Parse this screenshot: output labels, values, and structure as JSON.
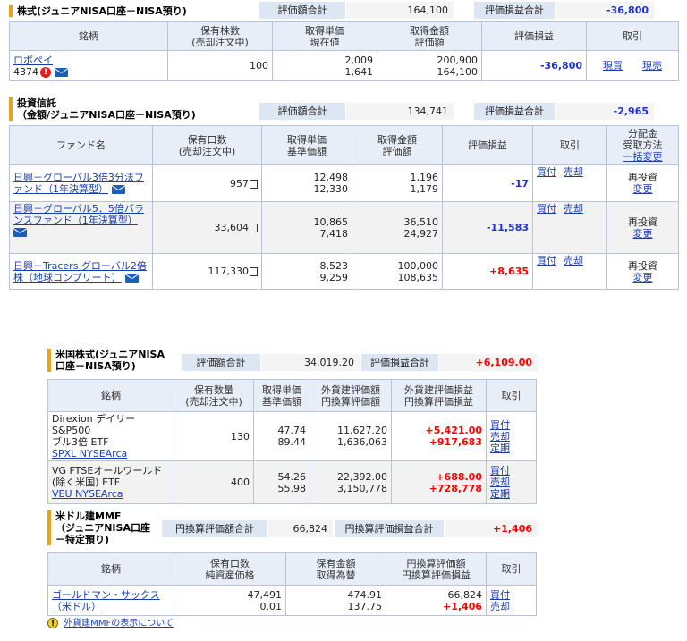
{
  "stocks": {
    "title": "株式(ジュニアNISA口座－NISA預り)",
    "summary": {
      "value_label": "評価額合計",
      "value": "164,100",
      "gain_label": "評価損益合計",
      "gain": "-36,800"
    },
    "headers": [
      "銘柄",
      "保有株数\n(売却注文中)",
      "取得単価\n現在値",
      "取得金額\n評価額",
      "評価損益",
      "取引"
    ],
    "row": {
      "name": "ロボペイ",
      "code": "4374",
      "shares": "100",
      "cost": "2,009",
      "price": "1,641",
      "acq": "200,900",
      "eval": "164,100",
      "gain": "-36,800",
      "buy": "現買",
      "sell": "現売"
    }
  },
  "funds": {
    "title1": "投資信託",
    "title2": "（金額/ジュニアNISA口座－NISA預り)",
    "summary": {
      "value_label": "評価額合計",
      "value": "134,741",
      "gain_label": "評価損益合計",
      "gain": "-2,965"
    },
    "headers": [
      "ファンド名",
      "保有口数\n(売却注文中)",
      "取得単価\n基準価額",
      "取得金額\n評価額",
      "評価損益",
      "取引"
    ],
    "dist_header": {
      "line1": "分配金",
      "line2": "受取方法",
      "link": "一括変更"
    },
    "rows": [
      {
        "name": "日興－グローバル3倍3分法ファンド（1年決算型）",
        "units": "957",
        "cost": "12,498",
        "nav": "12,330",
        "acq": "1,196",
        "eval": "1,179",
        "gain": "-17",
        "buy": "買付",
        "sell": "売却",
        "dist": "再投資",
        "change": "変更"
      },
      {
        "name": "日興－グローバル5．5倍バランスファンド（1年決算型）",
        "units": "33,604",
        "cost": "10,865",
        "nav": "7,418",
        "acq": "36,510",
        "eval": "24,927",
        "gain": "-11,583",
        "buy": "買付",
        "sell": "売却",
        "dist": "再投資",
        "change": "変更"
      },
      {
        "name": "日興－Tracers グローバル2倍株（地球コンプリート）",
        "units": "117,330",
        "cost": "8,523",
        "nav": "9,259",
        "acq": "100,000",
        "eval": "108,635",
        "gain": "+8,635",
        "buy": "買付",
        "sell": "売却",
        "dist": "再投資",
        "change": "変更"
      }
    ]
  },
  "us": {
    "title1": "米国株式(ジュニアNISA",
    "title2": "口座－NISA預り)",
    "summary": {
      "value_label": "評価額合計",
      "value": "34,019.20",
      "gain_label": "評価損益合計",
      "gain": "+6,109.00"
    },
    "headers": [
      "銘柄",
      "保有数量\n(売却注文中)",
      "取得単価\n基準価額",
      "外貨建評価額\n円換算評価額",
      "外貨建評価損益\n円換算評価損益",
      "取引"
    ],
    "rows": [
      {
        "name1": "Direxion デイリーS&P500",
        "name2": "ブル3倍 ETF",
        "ticker": "SPXL NYSEArca",
        "qty": "130",
        "cost": "47.74",
        "price": "89.44",
        "fx_eval": "11,627.20",
        "jpy_eval": "1,636,063",
        "fx_gain": "+5,421.00",
        "jpy_gain": "+917,683",
        "buy": "買付",
        "sell": "売却",
        "order": "定期"
      },
      {
        "name1": "VG FTSEオールワールド",
        "name2": "(除く米国) ETF",
        "ticker": "VEU NYSEArca",
        "qty": "400",
        "cost": "54.26",
        "price": "55.98",
        "fx_eval": "22,392.00",
        "jpy_eval": "3,150,778",
        "fx_gain": "+688.00",
        "jpy_gain": "+728,778",
        "buy": "買付",
        "sell": "売却",
        "order": "定期"
      }
    ]
  },
  "mmf": {
    "title1": "米ドル建MMF",
    "title2": "（ジュニアNISA口座",
    "title3": "－特定預り)",
    "summary": {
      "value_label": "円換算評価額合計",
      "value": "66,824",
      "gain_label": "円換算評価損益合計",
      "gain": "+1,406"
    },
    "headers": [
      "銘柄",
      "保有口数\n純資産価格",
      "保有金額\n取得為替",
      "円換算評価額\n円換算評価損益",
      "取引"
    ],
    "row": {
      "name": "ゴールドマン・サックス（米ドル）",
      "units": "47,491",
      "nav": "0.01",
      "amount": "474.91",
      "rate": "137.75",
      "jpy_eval": "66,824",
      "jpy_gain": "+1,406",
      "buy": "買付",
      "sell": "売却"
    },
    "note": "外貨建MMFの表示について"
  },
  "colors": {
    "negative": "#1f2fd8",
    "positive": "#ff0000",
    "header_bg": "#e7eef8",
    "section_accent": "#e8a317"
  }
}
